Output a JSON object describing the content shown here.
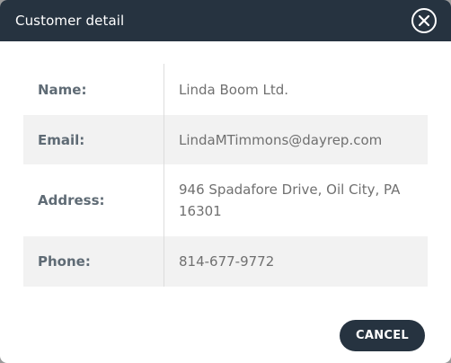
{
  "dialog": {
    "title": "Customer detail",
    "close_icon": "close-circle-icon"
  },
  "details": {
    "name_label": "Name:",
    "name_value": "Linda Boom Ltd.",
    "email_label": "Email:",
    "email_value": "LindaMTimmons@dayrep.com",
    "address_label": "Address:",
    "address_value": "946 Spadafore Drive, Oil City, PA 16301",
    "phone_label": "Phone:",
    "phone_value": "814-677-9772"
  },
  "footer": {
    "cancel_label": "CANCEL"
  },
  "colors": {
    "header_bg": "#263340",
    "row_shade": "#f2f2f2",
    "label_text": "#5f6b75",
    "value_text": "#707070"
  }
}
